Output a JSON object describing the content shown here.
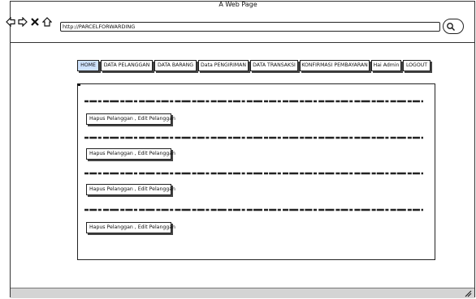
{
  "window": {
    "title": "A Web Page"
  },
  "browser": {
    "url": "http://PARCELFORWARDING",
    "icons": [
      "back-arrow-icon",
      "forward-arrow-icon",
      "close-icon",
      "home-icon",
      "search-icon",
      "resize-grip-icon"
    ]
  },
  "menu": {
    "items": [
      {
        "label": "HOME",
        "active": true
      },
      {
        "label": "DATA PELANGGAN",
        "active": false
      },
      {
        "label": "DATA BARANG",
        "active": false
      },
      {
        "label": "Data PENGIRIMAN",
        "active": false
      },
      {
        "label": "DATA TRANSAKSI",
        "active": false
      },
      {
        "label": "KONFIRMASI PEMBAYARAN",
        "active": false
      },
      {
        "label": "Hai Admin",
        "active": false
      },
      {
        "label": "LOGOUT",
        "active": false
      }
    ],
    "active_color": "#cfe3ff"
  },
  "content": {
    "rows": [
      {
        "action_label": "Hapus Pelanggan , Edit Pelanggan"
      },
      {
        "action_label": "Hapus Pelanggan , Edit Pelanggan"
      },
      {
        "action_label": "Hapus Pelanggan , Edit Pelanggan"
      },
      {
        "action_label": "Hapus Pelanggan , Edit Pelanggan"
      }
    ]
  }
}
